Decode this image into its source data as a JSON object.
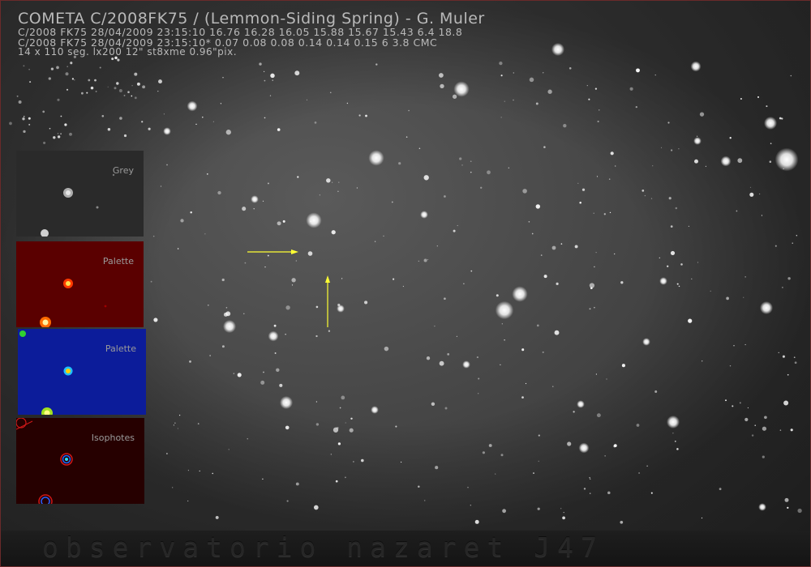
{
  "header": {
    "title": "COMETA C/2008FK75 / (Lemmon-Siding Spring) - G. Muler",
    "line1": "C/2008 FK75 28/04/2009 23:15:10 16.76 16.28 16.05 15.88 15.67 15.43 6.4 18.8",
    "line2": "C/2008 FK75 28/04/2009 23:15:10* 0.07 0.08 0.08 0.14 0.14 0.15 6 3.8 CMC",
    "line3": "14 x 110 seg. lx200 12\" st8xme 0.96\"pix."
  },
  "panels": [
    {
      "label": "Grey",
      "color": "#4a4a4a"
    },
    {
      "label": "Palette",
      "color": "#6a0000"
    },
    {
      "label": "Palette",
      "color": "#0a1aa0"
    },
    {
      "label": "Isophotes",
      "color": "#2a0000"
    }
  ],
  "footer": {
    "text": "observatorio nazaret J47"
  },
  "colors": {
    "arrow": "#ffff33",
    "star": "#ffffff",
    "sky": "#4a4a4a"
  }
}
